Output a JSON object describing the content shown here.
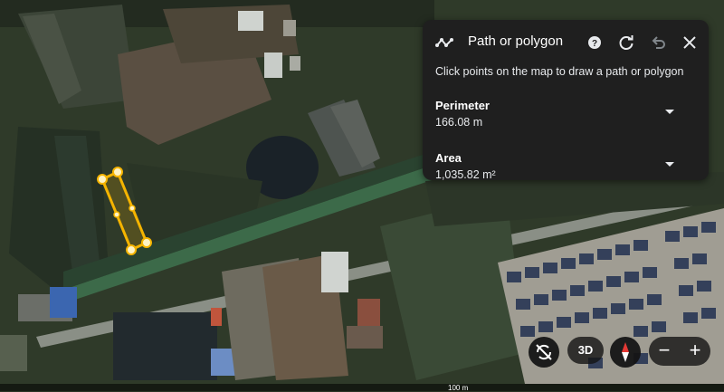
{
  "panel": {
    "title": "Path or polygon",
    "instruction": "Click points on the map to draw a path or polygon",
    "perimeter": {
      "label": "Perimeter",
      "value": "166.08 m"
    },
    "area": {
      "label": "Area",
      "value": "1,035.82 m²"
    },
    "icons": [
      "path-icon",
      "help-icon",
      "refresh-icon",
      "undo-icon",
      "close-icon"
    ]
  },
  "controls": {
    "view_3d": "3D",
    "zoom_out": "−",
    "zoom_in": "+",
    "icons": [
      "rotate-off-icon",
      "compass-icon"
    ]
  },
  "scale": {
    "label": "100 m"
  },
  "colors": {
    "polygon": "#f5b400",
    "panel_bg": "#1f1f1f"
  }
}
